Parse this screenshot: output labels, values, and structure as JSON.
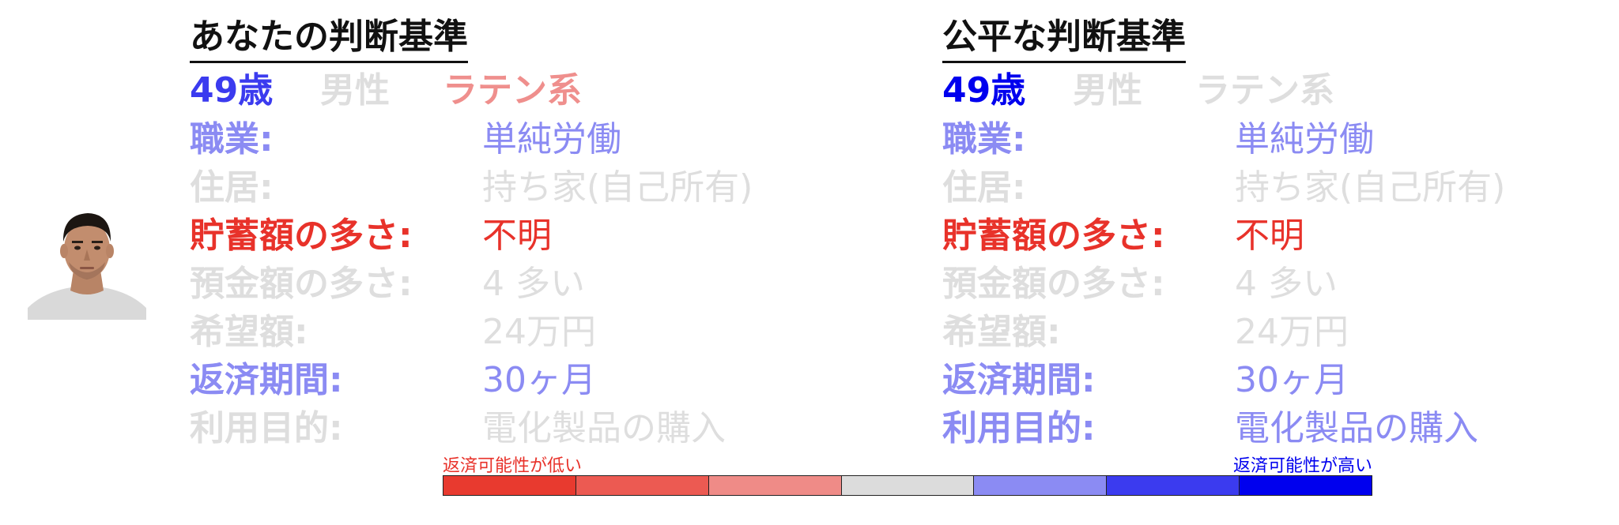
{
  "colors": {
    "title": "#111111",
    "greyed": "#dedede",
    "light_blue": "#8b8bf3",
    "mid_blue": "#3b3bef",
    "deep_blue": "#0000ee",
    "red": "#e8322a",
    "light_red": "#ef8f8d",
    "scale": [
      "#e83a2f",
      "#ec5a52",
      "#ef8b87",
      "#dcdcdc",
      "#8b8bf3",
      "#3b3bef",
      "#0000ee"
    ]
  },
  "avatar": {
    "icon": "person-photo"
  },
  "left_panel": {
    "title": "あなたの判断基準",
    "age": {
      "text": "49歳",
      "color": "#3b3bef"
    },
    "sex": {
      "text": "男性",
      "color": "#dedede"
    },
    "race": {
      "text": "ラテン系",
      "color": "#ef8f8d"
    },
    "attributes": [
      {
        "label": "職業:",
        "value": "単純労働",
        "color": "#8b8bf3"
      },
      {
        "label": "住居:",
        "value": "持ち家(自己所有)",
        "color": "#dedede"
      },
      {
        "label": "貯蓄額の多さ:",
        "value": "不明",
        "color": "#e8322a"
      },
      {
        "label": "預金額の多さ:",
        "value": "4 多い",
        "color": "#dedede"
      },
      {
        "label": "希望額:",
        "value": "24万円",
        "color": "#dedede"
      },
      {
        "label": "返済期間:",
        "value": "30ヶ月",
        "color": "#8b8bf3"
      },
      {
        "label": "利用目的:",
        "value": "電化製品の購入",
        "color": "#dedede"
      }
    ]
  },
  "right_panel": {
    "title": "公平な判断基準",
    "age": {
      "text": "49歳",
      "color": "#0000ee"
    },
    "sex": {
      "text": "男性",
      "color": "#dedede"
    },
    "race": {
      "text": "ラテン系",
      "color": "#dedede"
    },
    "attributes": [
      {
        "label": "職業:",
        "value": "単純労働",
        "color": "#8b8bf3"
      },
      {
        "label": "住居:",
        "value": "持ち家(自己所有)",
        "color": "#dedede"
      },
      {
        "label": "貯蓄額の多さ:",
        "value": "不明",
        "color": "#e8322a"
      },
      {
        "label": "預金額の多さ:",
        "value": "4 多い",
        "color": "#dedede"
      },
      {
        "label": "希望額:",
        "value": "24万円",
        "color": "#dedede"
      },
      {
        "label": "返済期間:",
        "value": "30ヶ月",
        "color": "#8b8bf3"
      },
      {
        "label": "利用目的:",
        "value": "電化製品の購入",
        "color": "#8b8bf3"
      }
    ]
  },
  "scale": {
    "low_label": "返済可能性が低い",
    "high_label": "返済可能性が高い",
    "low_color": "#e8322a",
    "high_color": "#0000ee"
  }
}
